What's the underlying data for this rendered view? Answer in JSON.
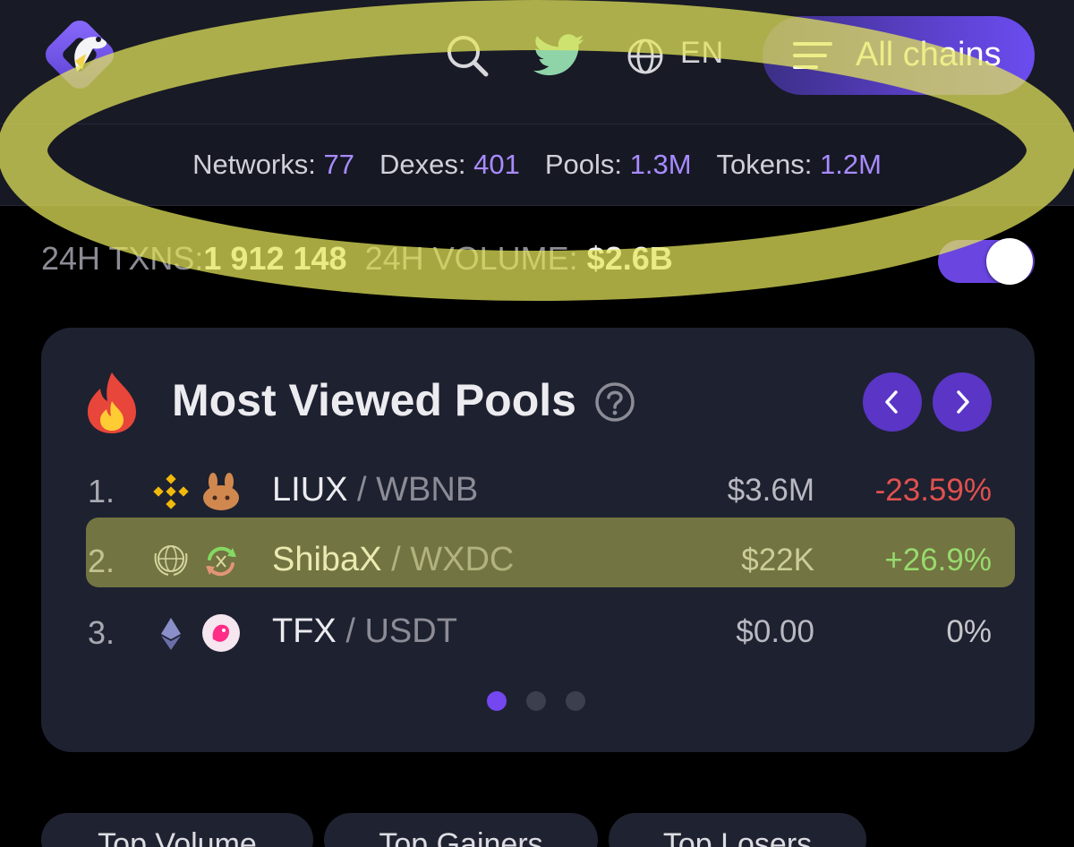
{
  "header": {
    "language": "EN",
    "chains_button_label": "All chains",
    "icons": [
      "gecko-logo-icon",
      "search-icon",
      "twitter-icon",
      "globe-icon",
      "menu-icon"
    ]
  },
  "stats": [
    {
      "label": "Networks:",
      "value": "77"
    },
    {
      "label": "Dexes:",
      "value": "401"
    },
    {
      "label": "Pools:",
      "value": "1.3M"
    },
    {
      "label": "Tokens:",
      "value": "1.2M"
    }
  ],
  "summary": {
    "txns_label": "24H TXNS:",
    "txns_value": "1 912 148",
    "volume_label": "24H VOLUME:",
    "volume_value": "$2.6B"
  },
  "card": {
    "title": "Most Viewed Pools",
    "rows": [
      {
        "rank": "1.",
        "base": "LIUX",
        "sep": "/",
        "quote": "WBNB",
        "volume": "$3.6M",
        "change": "-23.59%",
        "icons": [
          "bnb-chain-icon",
          "pancakeswap-icon"
        ]
      },
      {
        "rank": "2.",
        "base": "ShibaX",
        "sep": "/",
        "quote": "WXDC",
        "volume": "$22K",
        "change": "+26.9%",
        "icons": [
          "xinfin-icon",
          "swap-dex-icon"
        ]
      },
      {
        "rank": "3.",
        "base": "TFX",
        "sep": "/",
        "quote": "USDT",
        "volume": "$0.00",
        "change": "0%",
        "icons": [
          "ethereum-icon",
          "uniswap-icon"
        ]
      }
    ],
    "page_count": 3,
    "active_page": 1
  },
  "tabs": [
    {
      "label": "Top Volume"
    },
    {
      "label": "Top Gainers"
    },
    {
      "label": "Top Losers"
    }
  ],
  "colors": {
    "accent": "#6b4cf0",
    "stat_value": "#a88bff",
    "negative": "#e0514f",
    "positive": "#5fd17a",
    "highlight_marker": "#e6e85a"
  }
}
